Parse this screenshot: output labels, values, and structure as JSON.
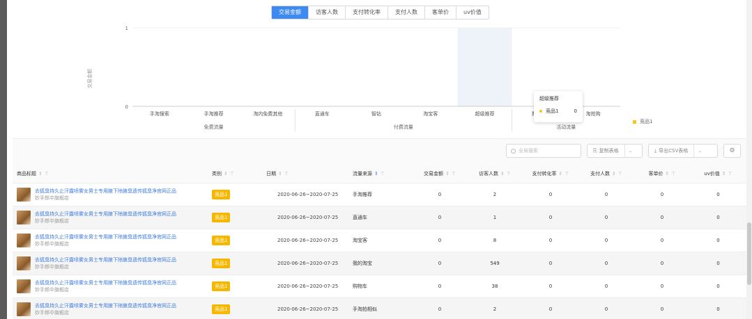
{
  "metric_tabs": [
    {
      "label": "交易金额",
      "active": true
    },
    {
      "label": "访客人数",
      "active": false
    },
    {
      "label": "支付转化率",
      "active": false
    },
    {
      "label": "支付人数",
      "active": false
    },
    {
      "label": "客单价",
      "active": false
    },
    {
      "label": "uv价值",
      "active": false
    }
  ],
  "chart_data": {
    "type": "bar",
    "ylabel": "交易金额",
    "ylim": [
      0,
      1
    ],
    "yticks": [
      "0",
      "1"
    ],
    "categories": [
      "手淘搜索",
      "手淘推荐",
      "淘内免费其他",
      "直通车",
      "智钻",
      "淘宝客",
      "超级推荐",
      "聚划算",
      "淘抢购"
    ],
    "groups": [
      {
        "label": "免费流量",
        "categories": [
          "手淘搜索",
          "手淘推荐",
          "淘内免费其他"
        ]
      },
      {
        "label": "付费流量",
        "categories": [
          "直通车",
          "智钻",
          "淘宝客",
          "超级推荐"
        ]
      },
      {
        "label": "活动流量",
        "categories": [
          "聚划算",
          "淘抢购"
        ]
      }
    ],
    "series": [
      {
        "name": "竞品1",
        "values": [
          0,
          0,
          0,
          0,
          0,
          0,
          0,
          0,
          0
        ],
        "color": "#f5c518"
      }
    ],
    "highlighted_category": "超级推荐",
    "legend_position": "right",
    "tooltip": {
      "title": "超级推荐",
      "series": "竞品1",
      "value": "0"
    }
  },
  "toolbar": {
    "search_placeholder": "全局搜索",
    "copy_label": "复制表格",
    "export_label": "导出CSV表格"
  },
  "table": {
    "columns": [
      "商品标题",
      "类别",
      "日期",
      "流量来源",
      "交易金额",
      "访客人数",
      "支付转化率",
      "支付人数",
      "客单价",
      "uv价值"
    ],
    "rows": [
      {
        "title": "去狐臭持久止汗露喷雾女男士专用腋下除腋臭遗传狐臭净官网正品",
        "shop": "妙手郎中旗舰店",
        "tag": "竞品1",
        "date": "2020-06-26~2020-07-25",
        "source": "手淘推荐",
        "amount": "0",
        "visitors": "2",
        "conversion": "0",
        "payers": "0",
        "aov": "0",
        "uv": "0"
      },
      {
        "title": "去狐臭持久止汗露喷雾女男士专用腋下除腋臭遗传狐臭净官网正品",
        "shop": "妙手郎中旗舰店",
        "tag": "竞品1",
        "date": "2020-06-26~2020-07-25",
        "source": "直通车",
        "amount": "0",
        "visitors": "1",
        "conversion": "0",
        "payers": "0",
        "aov": "0",
        "uv": "0"
      },
      {
        "title": "去狐臭持久止汗露喷雾女男士专用腋下除腋臭遗传狐臭净官网正品",
        "shop": "妙手郎中旗舰店",
        "tag": "竞品1",
        "date": "2020-06-26~2020-07-25",
        "source": "淘宝客",
        "amount": "0",
        "visitors": "8",
        "conversion": "0",
        "payers": "0",
        "aov": "0",
        "uv": "0"
      },
      {
        "title": "去狐臭持久止汗露喷雾女男士专用腋下除腋臭遗传狐臭净官网正品",
        "shop": "妙手郎中旗舰店",
        "tag": "竞品1",
        "date": "2020-06-26~2020-07-25",
        "source": "我的淘宝",
        "amount": "0",
        "visitors": "549",
        "conversion": "0",
        "payers": "0",
        "aov": "0",
        "uv": "0"
      },
      {
        "title": "去狐臭持久止汗露喷雾女男士专用腋下除腋臭遗传狐臭净官网正品",
        "shop": "妙手郎中旗舰店",
        "tag": "竞品1",
        "date": "2020-06-26~2020-07-25",
        "source": "购物车",
        "amount": "0",
        "visitors": "38",
        "conversion": "0",
        "payers": "0",
        "aov": "0",
        "uv": "0"
      },
      {
        "title": "去狐臭持久止汗露喷雾女男士专用腋下除腋臭遗传狐臭净官网正品",
        "shop": "妙手郎中旗舰店",
        "tag": "竞品1",
        "date": "2020-06-26~2020-07-25",
        "source": "手淘拍相似",
        "amount": "0",
        "visitors": "2",
        "conversion": "0",
        "payers": "0",
        "aov": "0",
        "uv": "0"
      }
    ]
  }
}
